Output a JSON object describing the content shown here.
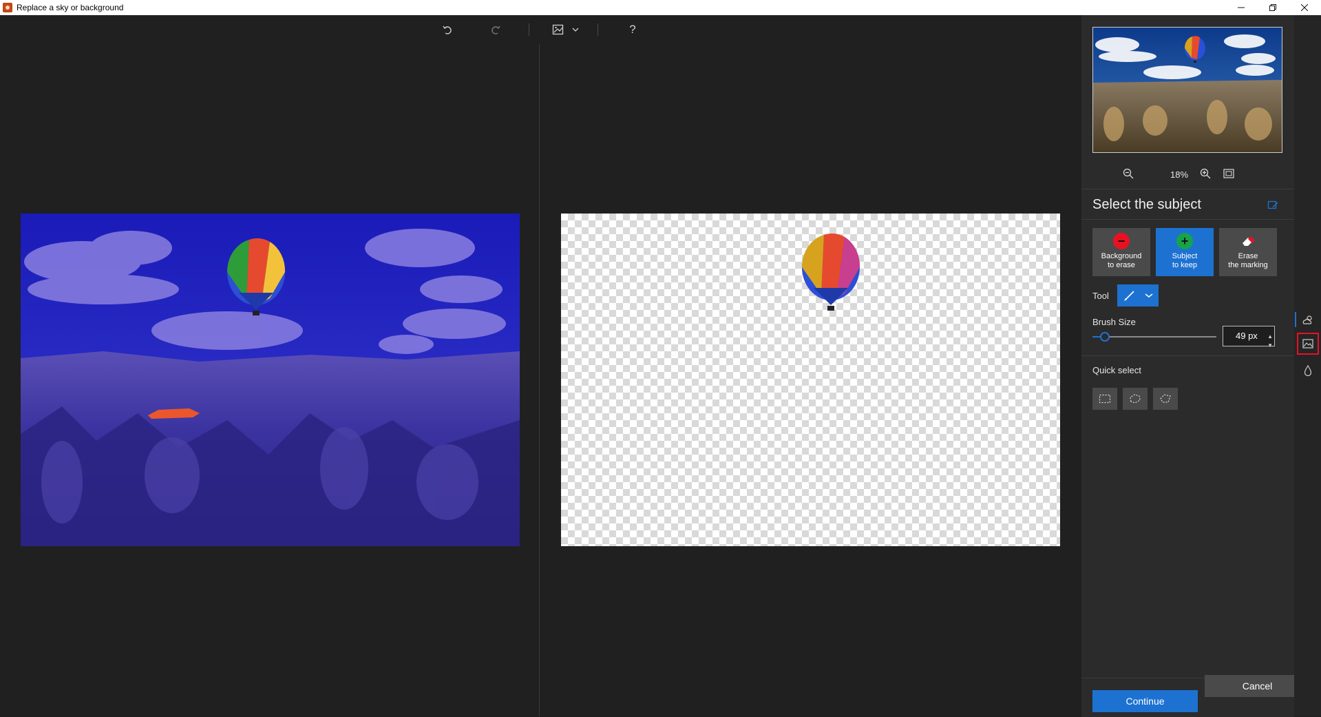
{
  "window": {
    "title": "Replace a sky or background",
    "minimize_icon": "minimize-icon",
    "restore_icon": "restore-icon",
    "close_icon": "close-icon"
  },
  "toolbar": {
    "undo_icon": "undo-icon",
    "redo_icon": "redo-icon",
    "view_icon": "compare-view-icon",
    "help_label": "?"
  },
  "preview": {
    "zoom_value": "18%"
  },
  "subject": {
    "title": "Select the subject",
    "modes": [
      {
        "line1": "Background",
        "line2": "to erase",
        "icon": "minus-circle-icon",
        "color": "#e81123"
      },
      {
        "line1": "Subject",
        "line2": "to keep",
        "icon": "plus-circle-icon",
        "color": "#16a34a"
      },
      {
        "line1": "Erase",
        "line2": "the marking",
        "icon": "eraser-icon",
        "color": "#ffffff"
      }
    ],
    "tool_label": "Tool",
    "brush_size_label": "Brush Size",
    "brush_size_value": "49 px",
    "brush_slider_fraction": 0.1,
    "quick_select_label": "Quick select"
  },
  "actions": {
    "continue_label": "Continue",
    "cancel_label": "Cancel"
  },
  "colors": {
    "accent": "#1d72d1",
    "highlight": "#e81123"
  }
}
